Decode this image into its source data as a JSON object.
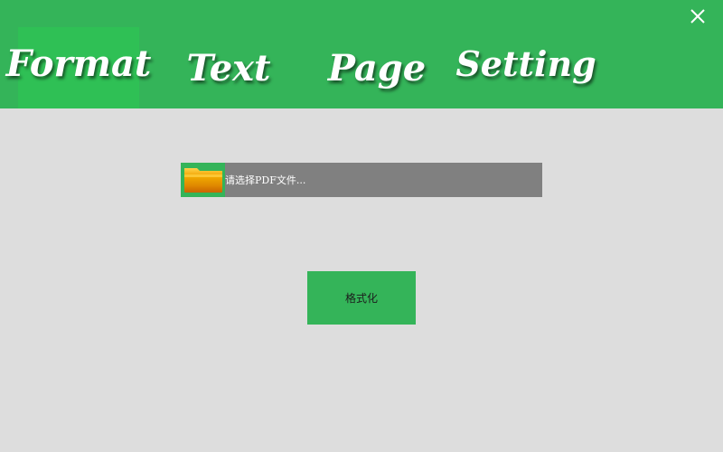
{
  "colors": {
    "accent": "#34b459",
    "active_tab": "#2fc055",
    "background": "#dddddd",
    "path_field": "#808080",
    "folder_icon": "#f0a800"
  },
  "tabs": [
    {
      "label": "Format",
      "active": true
    },
    {
      "label": "Text",
      "active": false
    },
    {
      "label": "Page",
      "active": false
    },
    {
      "label": "Setting",
      "active": false
    }
  ],
  "window": {
    "close_icon": "close-icon"
  },
  "file_picker": {
    "icon": "folder-icon",
    "placeholder": "请选择PDF文件..."
  },
  "actions": {
    "format_label": "格式化"
  }
}
